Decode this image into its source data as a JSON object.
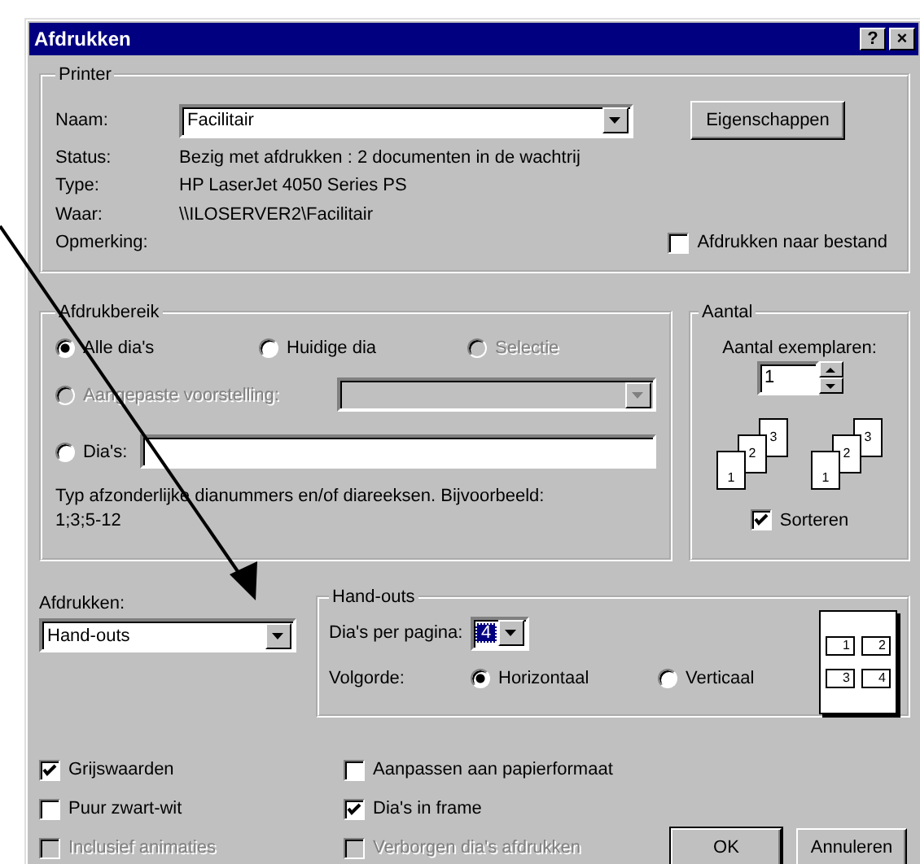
{
  "window": {
    "title": "Afdrukken",
    "title_buttons": [
      "?",
      "×"
    ]
  },
  "printer": {
    "legend": "Printer",
    "name_label": "Naam:",
    "name_value": "Facilitair",
    "properties_button": "Eigenschappen",
    "info": [
      {
        "label": "Status:",
        "value": "Bezig met afdrukken : 2 documenten in de wachtrij"
      },
      {
        "label": "Type:",
        "value": "HP LaserJet 4050 Series PS"
      },
      {
        "label": "Waar:",
        "value": "\\\\ILOSERVER2\\Facilitair"
      },
      {
        "label": "Opmerking:"
      }
    ],
    "print_to_file": {
      "label": "Afdrukken naar bestand",
      "checked": false
    }
  },
  "range": {
    "legend": "Afdrukbereik",
    "options": [
      {
        "label": "Alle dia's",
        "selected": true,
        "disabled": false
      },
      {
        "label": "Huidige dia",
        "selected": false,
        "disabled": false
      },
      {
        "label": "Selectie",
        "selected": false,
        "disabled": true
      }
    ],
    "custom_show": {
      "label": "Aangepaste voorstelling:",
      "selected": false,
      "disabled": true
    },
    "slides": {
      "label": "Dia's:",
      "selected": false,
      "disabled": false
    },
    "hint": "Typ afzonderlijke dianummers en/of diareeksen. Bijvoorbeeld: 1;3;5-12"
  },
  "copies": {
    "legend": "Aantal",
    "label": "Aantal exemplaren:",
    "value": "1",
    "collate_icons": [
      [
        "1",
        "2",
        "3"
      ],
      [
        "1",
        "2",
        "3"
      ]
    ],
    "collate": {
      "label": "Sorteren",
      "checked": true
    }
  },
  "print_what": {
    "label": "Afdrukken:",
    "value": "Hand-outs"
  },
  "handouts": {
    "legend": "Hand-outs",
    "per_page_label": "Dia's per pagina:",
    "per_page_value": "4",
    "order_label": "Volgorde:",
    "order": [
      {
        "label": "Horizontaal",
        "selected": true
      },
      {
        "label": "Verticaal",
        "selected": false
      }
    ],
    "preview": [
      "1",
      "2",
      "3",
      "4"
    ]
  },
  "options": [
    {
      "label": "Grijswaarden",
      "checked": true,
      "disabled": false
    },
    {
      "label": "Puur zwart-wit",
      "checked": false,
      "disabled": false
    },
    {
      "label": "Inclusief animaties",
      "checked": false,
      "disabled": true
    },
    {
      "label": "Aanpassen aan papierformaat",
      "checked": false,
      "disabled": false
    },
    {
      "label": "Dia's in frame",
      "checked": true,
      "disabled": false
    },
    {
      "label": "Verborgen dia's afdrukken",
      "checked": false,
      "disabled": true
    }
  ],
  "buttons": [
    "OK",
    "Annuleren"
  ]
}
